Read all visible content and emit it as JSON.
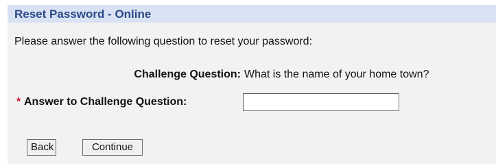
{
  "header": {
    "title": "Reset Password - Online"
  },
  "form": {
    "instruction": "Please answer the following question to reset your password:",
    "challenge_label": "Challenge Question:",
    "challenge_question": "What is the name of your home town?",
    "required_marker": "*",
    "answer_label": "Answer to Challenge Question:",
    "answer_value": ""
  },
  "buttons": {
    "back_label": "Back",
    "continue_label": "Continue"
  },
  "colors": {
    "header_bg": "#d9e2f2",
    "header_text": "#2b4a8a",
    "panel_bg": "#f2f2f2",
    "required": "#c8102e"
  }
}
